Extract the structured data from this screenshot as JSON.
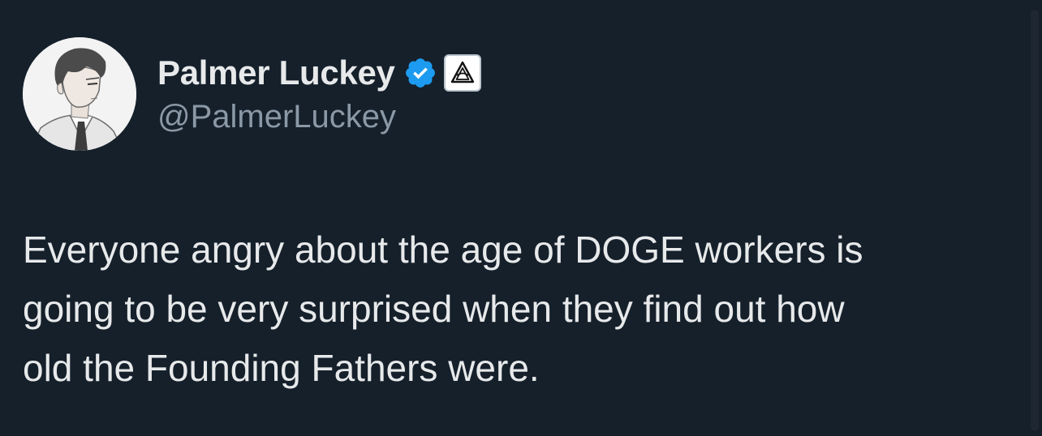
{
  "author": {
    "display_name": "Palmer Luckey",
    "handle": "@PalmerLuckey",
    "verified_icon": "verified-check-icon",
    "affiliate_icon": "anduril-logo-icon",
    "avatar": "anime-style-portrait"
  },
  "tweet": {
    "text_lines": [
      "Everyone angry about the age of DOGE workers is",
      "going to be very surprised when they find out how",
      "old the Founding Fathers were."
    ]
  },
  "colors": {
    "background": "#15202b",
    "text_primary": "#e7e9ea",
    "text_secondary": "#8b98a5",
    "verified_blue": "#1d9bf0"
  }
}
